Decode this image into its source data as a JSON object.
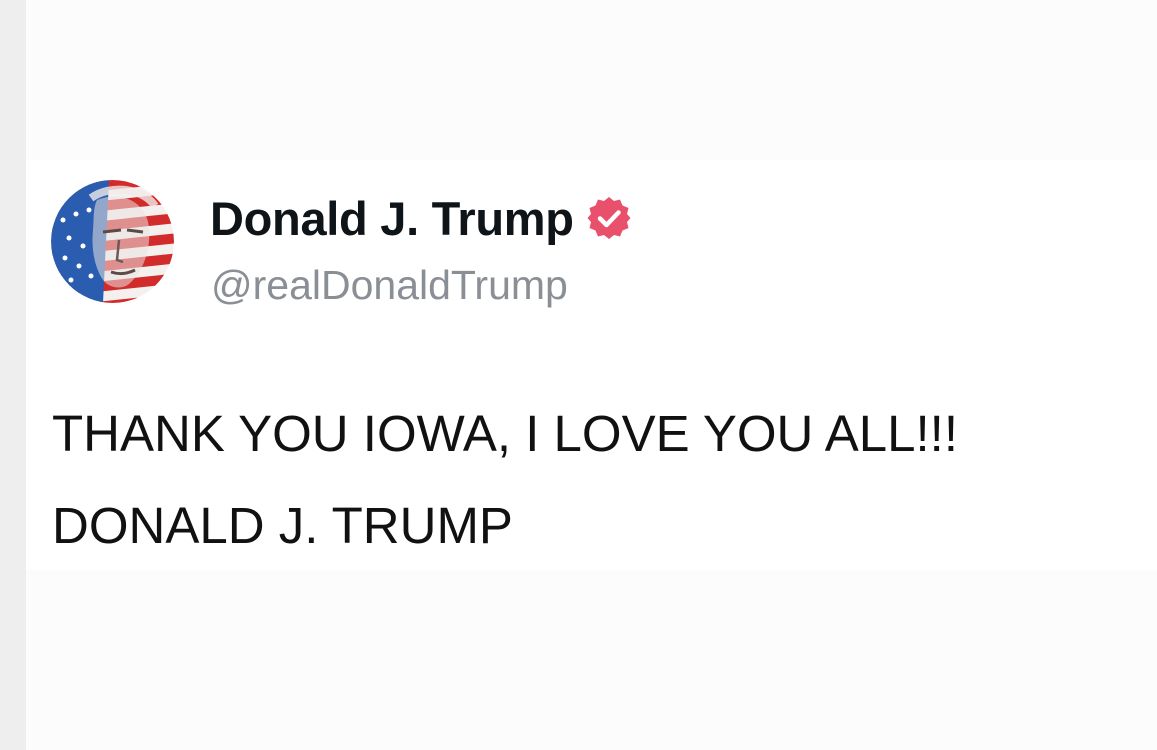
{
  "post": {
    "author": {
      "display_name": "Donald J. Trump",
      "handle": "@realDonaldTrump",
      "verified_icon": "verified-badge-icon",
      "verified_color": "#e8506c"
    },
    "text_lines": [
      "THANK YOU IOWA, I LOVE YOU ALL!!!",
      "DONALD J. TRUMP"
    ]
  },
  "colors": {
    "name": "#0f1419",
    "handle": "#8a8f95",
    "body_text": "#111111",
    "flag_red": "#d22b2b",
    "flag_blue": "#2a5db0"
  }
}
